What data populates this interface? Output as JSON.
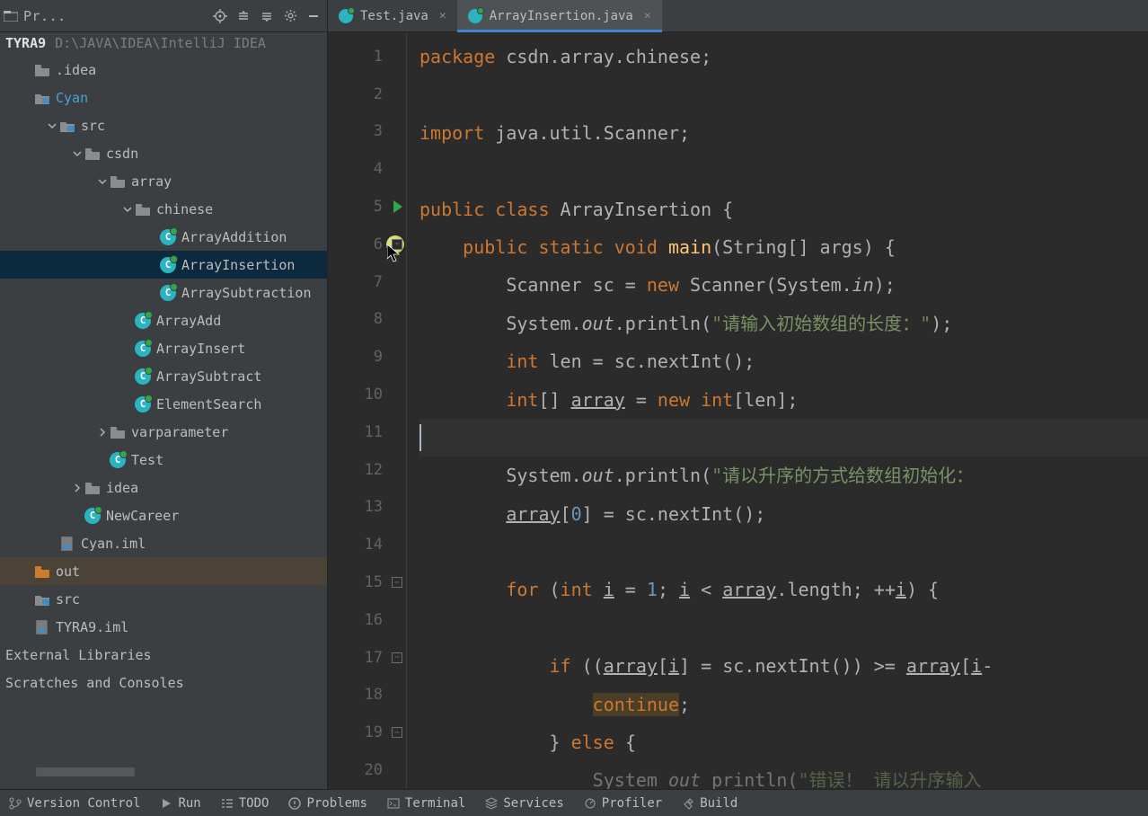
{
  "sidebar": {
    "title": "Pr...",
    "breadcrumb_root": "TYRA9",
    "breadcrumb_path": "D:\\JAVA\\IDEA\\IntelliJ IDEA",
    "tree": [
      {
        "label": ".idea",
        "indent": 0,
        "icon": "folder",
        "expanded": null
      },
      {
        "label": "Cyan",
        "indent": 0,
        "icon": "folder-blue",
        "expanded": null,
        "cyan": true
      },
      {
        "label": "src",
        "indent": 1,
        "icon": "folder-blue",
        "expanded": true
      },
      {
        "label": "csdn",
        "indent": 2,
        "icon": "folder",
        "expanded": true
      },
      {
        "label": "array",
        "indent": 3,
        "icon": "folder",
        "expanded": true
      },
      {
        "label": "chinese",
        "indent": 4,
        "icon": "folder",
        "expanded": true
      },
      {
        "label": "ArrayAddition",
        "indent": 5,
        "icon": "class"
      },
      {
        "label": "ArrayInsertion",
        "indent": 5,
        "icon": "class",
        "selected": true
      },
      {
        "label": "ArraySubtraction",
        "indent": 5,
        "icon": "class"
      },
      {
        "label": "ArrayAdd",
        "indent": 4,
        "icon": "class"
      },
      {
        "label": "ArrayInsert",
        "indent": 4,
        "icon": "class"
      },
      {
        "label": "ArraySubtract",
        "indent": 4,
        "icon": "class"
      },
      {
        "label": "ElementSearch",
        "indent": 4,
        "icon": "class"
      },
      {
        "label": "varparameter",
        "indent": 3,
        "icon": "folder",
        "expanded": false
      },
      {
        "label": "Test",
        "indent": 3,
        "icon": "class"
      },
      {
        "label": "idea",
        "indent": 2,
        "icon": "folder",
        "expanded": false
      },
      {
        "label": "NewCareer",
        "indent": 2,
        "icon": "class"
      },
      {
        "label": "Cyan.iml",
        "indent": 1,
        "icon": "iml"
      },
      {
        "label": "out",
        "indent": 0,
        "icon": "folder-orange",
        "hlout": true
      },
      {
        "label": "src",
        "indent": 0,
        "icon": "folder-blue"
      },
      {
        "label": "TYRA9.iml",
        "indent": 0,
        "icon": "iml"
      },
      {
        "label": "External Libraries",
        "indent": -1,
        "plain": true
      },
      {
        "label": "Scratches and Consoles",
        "indent": -1,
        "plain": true
      }
    ]
  },
  "tabs": [
    {
      "label": "Test.java",
      "active": false
    },
    {
      "label": "ArrayInsertion.java",
      "active": true
    }
  ],
  "code": {
    "lines": [
      {
        "n": 1,
        "segs": [
          [
            "kw",
            "package "
          ],
          [
            "name",
            "csdn.array.chinese"
          ],
          [
            "name",
            ";"
          ]
        ]
      },
      {
        "n": 2,
        "segs": []
      },
      {
        "n": 3,
        "segs": [
          [
            "kw",
            "import "
          ],
          [
            "name",
            "java.util.Scanner"
          ],
          [
            "name",
            ";"
          ]
        ]
      },
      {
        "n": 4,
        "segs": []
      },
      {
        "n": 5,
        "run": true,
        "segs": [
          [
            "kw",
            "public class "
          ],
          [
            "name",
            "ArrayInsertion {"
          ]
        ]
      },
      {
        "n": 6,
        "bp": true,
        "fold": true,
        "indent": 1,
        "segs": [
          [
            "kw",
            "public static void "
          ],
          [
            "fn",
            "main"
          ],
          [
            "name",
            "(String[] args) {"
          ]
        ]
      },
      {
        "n": 7,
        "indent": 2,
        "segs": [
          [
            "name",
            "Scanner sc = "
          ],
          [
            "kw",
            "new "
          ],
          [
            "name",
            "Scanner(System."
          ],
          [
            "italic",
            "in"
          ],
          [
            "name",
            ");"
          ]
        ]
      },
      {
        "n": 8,
        "indent": 2,
        "segs": [
          [
            "name",
            "System."
          ],
          [
            "italic",
            "out"
          ],
          [
            "name",
            ".println("
          ],
          [
            "str",
            "\""
          ],
          [
            "str-zh",
            "请输入初始数组的长度："
          ],
          [
            "str",
            "\""
          ],
          [
            "name",
            ");"
          ]
        ]
      },
      {
        "n": 9,
        "indent": 2,
        "segs": [
          [
            "kw",
            "int "
          ],
          [
            "name",
            "len = sc.nextInt();"
          ]
        ]
      },
      {
        "n": 10,
        "indent": 2,
        "segs": [
          [
            "kw",
            "int"
          ],
          [
            "name",
            "[] "
          ],
          [
            "underl",
            "array"
          ],
          [
            "name",
            " = "
          ],
          [
            "kw",
            "new int"
          ],
          [
            "name",
            "[len];"
          ]
        ]
      },
      {
        "n": 11,
        "hl": true,
        "cursor": true,
        "segs": []
      },
      {
        "n": 12,
        "indent": 2,
        "segs": [
          [
            "name",
            "System."
          ],
          [
            "italic",
            "out"
          ],
          [
            "name",
            ".println("
          ],
          [
            "str",
            "\""
          ],
          [
            "str-zh",
            "请以升序的方式给数组初始化："
          ],
          [
            "name",
            ""
          ]
        ]
      },
      {
        "n": 13,
        "indent": 2,
        "segs": [
          [
            "underl",
            "array"
          ],
          [
            "name",
            "["
          ],
          [
            "num",
            "0"
          ],
          [
            "name",
            "] = sc.nextInt();"
          ]
        ]
      },
      {
        "n": 14,
        "segs": []
      },
      {
        "n": 15,
        "fold": true,
        "indent": 2,
        "segs": [
          [
            "kw",
            "for "
          ],
          [
            "name",
            "("
          ],
          [
            "kw",
            "int "
          ],
          [
            "underl",
            "i"
          ],
          [
            "name",
            " = "
          ],
          [
            "num",
            "1"
          ],
          [
            "name",
            "; "
          ],
          [
            "underl",
            "i"
          ],
          [
            "name",
            " < "
          ],
          [
            "underl",
            "array"
          ],
          [
            "name",
            "."
          ],
          [
            "name",
            "length; ++"
          ],
          [
            "underl",
            "i"
          ],
          [
            "name",
            ") {"
          ]
        ]
      },
      {
        "n": 16,
        "segs": []
      },
      {
        "n": 17,
        "fold": true,
        "indent": 3,
        "segs": [
          [
            "kw",
            "if "
          ],
          [
            "name",
            "(("
          ],
          [
            "underl",
            "array"
          ],
          [
            "name",
            "["
          ],
          [
            "underl",
            "i"
          ],
          [
            "name",
            "] = sc.nextInt()) >= "
          ],
          [
            "underl",
            "array"
          ],
          [
            "name",
            "["
          ],
          [
            "underl",
            "i"
          ],
          [
            "name",
            "-"
          ]
        ]
      },
      {
        "n": 18,
        "indent": 4,
        "segs": [
          [
            "hl-cont-kw",
            "continue"
          ],
          [
            "name",
            ";"
          ]
        ]
      },
      {
        "n": 19,
        "fold": true,
        "indent": 3,
        "segs": [
          [
            "name",
            "} "
          ],
          [
            "kw",
            "else "
          ],
          [
            "name",
            "{"
          ]
        ]
      },
      {
        "n": 20,
        "indent": 4,
        "dim": true,
        "segs": [
          [
            "name",
            "System "
          ],
          [
            "italic",
            "out"
          ],
          [
            "name",
            " println("
          ],
          [
            "str-zh",
            "\"错误！ 请以升序输入"
          ]
        ]
      }
    ]
  },
  "bottombar": {
    "items": [
      {
        "icon": "branch",
        "label": "Version Control"
      },
      {
        "icon": "play",
        "label": "Run"
      },
      {
        "icon": "todo",
        "label": "TODO"
      },
      {
        "icon": "problems",
        "label": "Problems"
      },
      {
        "icon": "terminal",
        "label": "Terminal"
      },
      {
        "icon": "services",
        "label": "Services"
      },
      {
        "icon": "profiler",
        "label": "Profiler"
      },
      {
        "icon": "build",
        "label": "Build"
      }
    ]
  }
}
